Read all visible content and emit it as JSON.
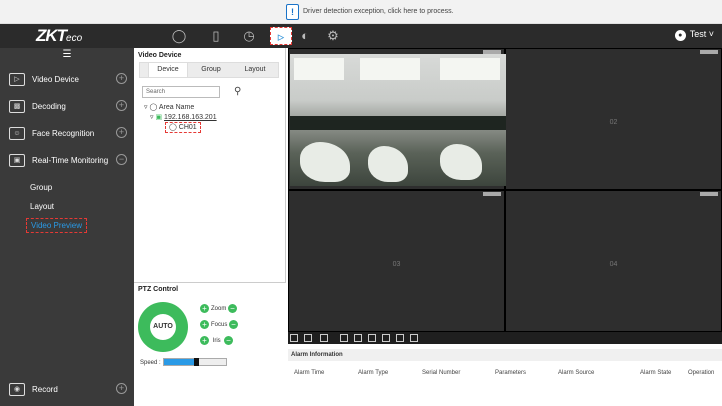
{
  "notice": {
    "text": "Driver detection exception, click here to process."
  },
  "logo": {
    "main": "ZKT",
    "sub": "eco"
  },
  "topnav": {
    "items": [
      "person-icon",
      "device-icon",
      "clock-icon",
      "video-icon",
      "shield-icon",
      "gear-icon"
    ],
    "user": "Test"
  },
  "sidebar": {
    "items": [
      {
        "label": "Video Device",
        "icon": "camera-icon",
        "state": "+"
      },
      {
        "label": "Decoding",
        "icon": "decoder-icon",
        "state": "+"
      },
      {
        "label": "Face Recognition",
        "icon": "face-icon",
        "state": "+"
      },
      {
        "label": "Real-Time Monitoring",
        "icon": "monitor-icon",
        "state": "−"
      },
      {
        "label": "Record",
        "icon": "record-icon",
        "state": "+"
      }
    ],
    "subitems": [
      "Group",
      "Layout",
      "Video Preview"
    ]
  },
  "device_panel": {
    "title": "Video Device",
    "tabs": [
      "Device",
      "Group",
      "Layout"
    ],
    "search_placeholder": "Search",
    "tree": {
      "area": "Area Name",
      "ip": "192.168.163.201",
      "channel": "CH01"
    }
  },
  "ptz": {
    "title": "PTZ Control",
    "center": "AUTO",
    "controls": [
      "Zoom",
      "Focus",
      "Iris"
    ],
    "speed_label": "Speed :",
    "speed_level": 0.55
  },
  "grid": {
    "cells": [
      "",
      "02",
      "03",
      "04"
    ]
  },
  "alarm": {
    "title": "Alarm Information",
    "columns": [
      "Alarm Time",
      "Alarm Type",
      "Serial Number",
      "Parameters",
      "Alarm Source",
      "Alarm State",
      "Operation"
    ]
  },
  "colors": {
    "accent": "#2a9ae6",
    "green": "#3dbb5c",
    "sidebar": "#3a3a3a"
  }
}
